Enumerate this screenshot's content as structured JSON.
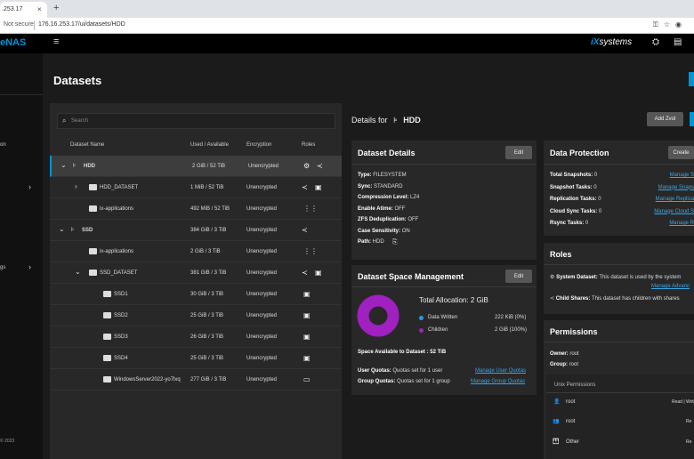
{
  "browser": {
    "tab_title": ".253.17",
    "tab_close": "×",
    "tab_new": "+",
    "not_secure": "Not secure",
    "url": "176.16.253.17/ui/datasets/HDD",
    "icons": [
      "key-icon",
      "star-icon",
      "profile-icon"
    ]
  },
  "header": {
    "logo": "eNAS",
    "hamburger": "≡",
    "brand_prefix": "iX",
    "brand_suffix": "systems"
  },
  "sidebar": {
    "items": [
      "on",
      "gs"
    ],
    "footer": [
      "© 2023"
    ]
  },
  "page": {
    "title": "Datasets",
    "search_placeholder": "Search"
  },
  "table": {
    "headers": [
      "Dataset Name",
      "Used / Available",
      "Encryption",
      "Roles"
    ],
    "rows": [
      {
        "name": "HDD",
        "used": "2 GiB / 52 TiB",
        "enc": "Unencrypted",
        "level": 0,
        "expand": "⌄",
        "selected": true
      },
      {
        "name": "HDD_DATASET",
        "used": "1 MiB / 52 TiB",
        "enc": "Unencrypted",
        "level": 1,
        "expand": "›",
        "selected": false
      },
      {
        "name": "ix-applications",
        "used": "492 MiB / 52 TiB",
        "enc": "Unencrypted",
        "level": 1,
        "expand": "",
        "selected": false
      },
      {
        "name": "SSD",
        "used": "384 GiB / 3 TiB",
        "enc": "Unencrypted",
        "level": 0,
        "expand": "⌄",
        "selected": false
      },
      {
        "name": "ix-applications",
        "used": "2 GiB / 3 TiB",
        "enc": "Unencrypted",
        "level": 1,
        "expand": "",
        "selected": false
      },
      {
        "name": "SSD_DATASET",
        "used": "381 GiB / 3 TiB",
        "enc": "Unencrypted",
        "level": 1,
        "expand": "⌄",
        "selected": false
      },
      {
        "name": "SSD1",
        "used": "30 GiB / 3 TiB",
        "enc": "Unencrypted",
        "level": 2,
        "expand": "",
        "selected": false
      },
      {
        "name": "SSD2",
        "used": "25 GiB / 3 TiB",
        "enc": "Unencrypted",
        "level": 2,
        "expand": "",
        "selected": false
      },
      {
        "name": "SSD3",
        "used": "26 GiB / 3 TiB",
        "enc": "Unencrypted",
        "level": 2,
        "expand": "",
        "selected": false
      },
      {
        "name": "SSD4",
        "used": "25 GiB / 3 TiB",
        "enc": "Unencrypted",
        "level": 2,
        "expand": "",
        "selected": false
      },
      {
        "name": "WindowsServer2022-yo7lxq",
        "used": "277 GiB / 3 TiB",
        "enc": "Unencrypted",
        "level": 2,
        "expand": "",
        "selected": false
      }
    ]
  },
  "details": {
    "prefix": "Details for",
    "name": "HDD",
    "add_zvol": "Add Zvol"
  },
  "dataset_details": {
    "title": "Dataset Details",
    "edit": "Edit",
    "fields": [
      {
        "k": "Type:",
        "v": "FILESYSTEM"
      },
      {
        "k": "Sync:",
        "v": "STANDARD"
      },
      {
        "k": "Compression Level:",
        "v": "LZ4"
      },
      {
        "k": "Enable Atime:",
        "v": "OFF"
      },
      {
        "k": "ZFS Deduplication:",
        "v": "OFF"
      },
      {
        "k": "Case Sensitivity:",
        "v": "ON"
      },
      {
        "k": "Path:",
        "v": "HDD"
      }
    ]
  },
  "space": {
    "title": "Dataset Space Management",
    "edit": "Edit",
    "total": "Total Allocation:  2 GiB",
    "legend": [
      {
        "label": "Data Written",
        "value": "222 KiB (0%)",
        "color": "#1e9fe0"
      },
      {
        "label": "Children",
        "value": "2 GiB (100%)",
        "color": "#a020c0"
      }
    ],
    "available": "Space Available to Dataset :  52 TiB",
    "user_quota_k": "User Quotas:",
    "user_quota_v": "Quotas set for 1 user",
    "user_quota_link": "Manage User Quotas",
    "group_quota_k": "Group Quotas:",
    "group_quota_v": "Quotas set for 1 group",
    "group_quota_link": "Manage Group Quotas"
  },
  "protection": {
    "title": "Data Protection",
    "create": "Create",
    "items": [
      {
        "k": "Total Snapshots:",
        "v": "0",
        "link": "Manage S"
      },
      {
        "k": "Snapshot Tasks:",
        "v": "0",
        "link": "Manage Snaps"
      },
      {
        "k": "Replication Tasks:",
        "v": "0",
        "link": "Manage Replica"
      },
      {
        "k": "Cloud Sync Tasks:",
        "v": "0",
        "link": "Manage Cloud S"
      },
      {
        "k": "Rsync Tasks:",
        "v": "0",
        "link": "Manage R"
      }
    ]
  },
  "roles": {
    "title": "Roles",
    "system_k": "System Dataset:",
    "system_v": "This dataset is used by the system",
    "system_link": "Manage Advanc",
    "child_k": "Child Shares:",
    "child_v": "This dataset has children with shares"
  },
  "permissions": {
    "title": "Permissions",
    "owner_k": "Owner:",
    "owner_v": "root",
    "group_k": "Group:",
    "group_v": "root",
    "unix_title": "Unix Permissions",
    "entries": [
      {
        "name": "root",
        "perm": "Read | Writ"
      },
      {
        "name": "root",
        "perm": "Re"
      },
      {
        "name": "Other",
        "perm": "Re"
      }
    ]
  },
  "colors": {
    "accent": "#0095d5",
    "written": "#1e9fe0",
    "children": "#a020c0"
  },
  "space_chart": {
    "data_written_pct": 0,
    "children_pct": 100
  }
}
